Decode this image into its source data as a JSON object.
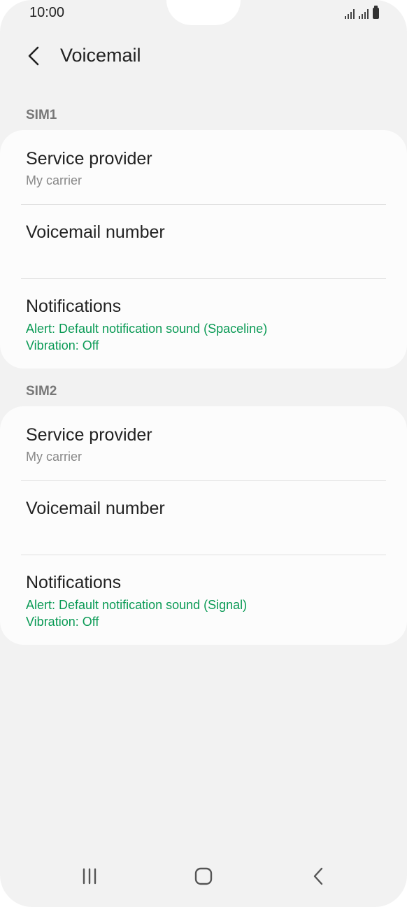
{
  "status_bar": {
    "time": "10:00",
    "icons": [
      "signal-sim1-icon",
      "signal-sim2-icon",
      "battery-icon"
    ]
  },
  "header": {
    "back_icon": "chevron-left-icon",
    "title": "Voicemail"
  },
  "sections": [
    {
      "label": "SIM1",
      "items": [
        {
          "title": "Service provider",
          "subtitle": "My carrier"
        },
        {
          "title": "Voicemail number"
        },
        {
          "title": "Notifications",
          "alert": "Alert: Default notification sound (Spaceline)",
          "vibration": "Vibration: Off"
        }
      ]
    },
    {
      "label": "SIM2",
      "items": [
        {
          "title": "Service provider",
          "subtitle": "My carrier"
        },
        {
          "title": "Voicemail number"
        },
        {
          "title": "Notifications",
          "alert": "Alert: Default notification sound (Signal)",
          "vibration": "Vibration: Off"
        }
      ]
    }
  ],
  "navbar": {
    "icons": [
      "recent-apps-icon",
      "home-icon",
      "back-icon"
    ]
  },
  "colors": {
    "accent_green": "#0a9a55",
    "background": "#f2f2f2",
    "card": "#fcfcfc"
  }
}
